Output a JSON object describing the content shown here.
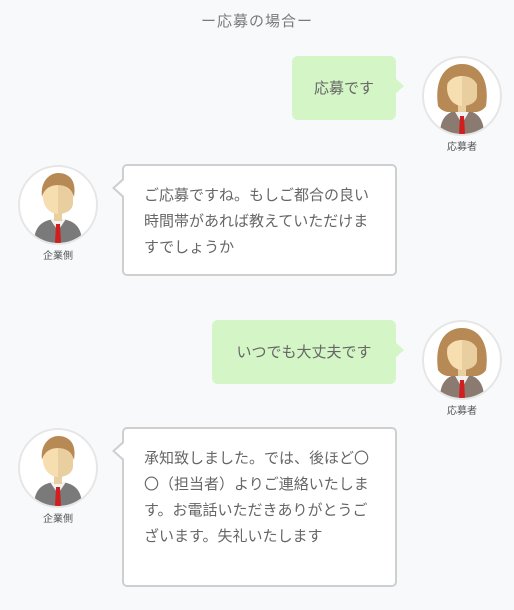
{
  "header": {
    "title": "ー応募の場合ー"
  },
  "roles": {
    "applicant": "応募者",
    "company": "企業側"
  },
  "messages": [
    {
      "speaker": "applicant",
      "text": "応募です"
    },
    {
      "speaker": "company",
      "text": "ご応募ですね。もしご都合の良い時間帯があれば教えていただけますでしょうか"
    },
    {
      "speaker": "applicant",
      "text": "いつでも大丈夫です"
    },
    {
      "speaker": "company",
      "text": "承知致しました。では、後ほど〇〇（担当者）よりご連絡いたします。お電話いただきありがとうございます。失礼いたします"
    }
  ],
  "colors": {
    "applicant_bubble": "#d4f5c5",
    "company_bubble_border": "#cfcfcf",
    "background": "#f8f9fb"
  },
  "icons": {
    "applicant": "female-avatar-icon",
    "company": "male-avatar-icon"
  }
}
